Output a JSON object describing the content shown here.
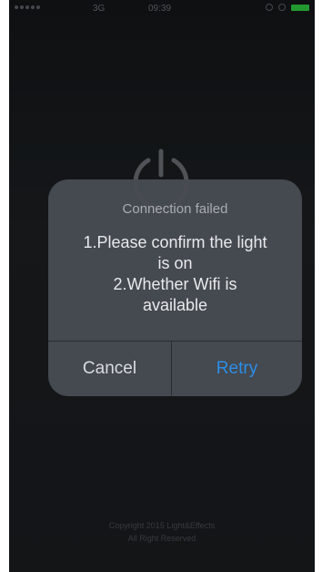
{
  "status_bar": {
    "carrier": "3G",
    "time": "09:39"
  },
  "dialog": {
    "title": "Connection failed",
    "message_lines": [
      "1.Please confirm the light",
      "is on",
      "2.Whether Wifi is",
      "available"
    ],
    "cancel_label": "Cancel",
    "retry_label": "Retry"
  },
  "footer": {
    "line1": "Copyright 2015 Light&Effects",
    "line2": "All Right Reserved"
  },
  "colors": {
    "accent": "#2b8ee6",
    "battery": "#2ecc40"
  },
  "icons": {
    "center": "power-icon"
  }
}
